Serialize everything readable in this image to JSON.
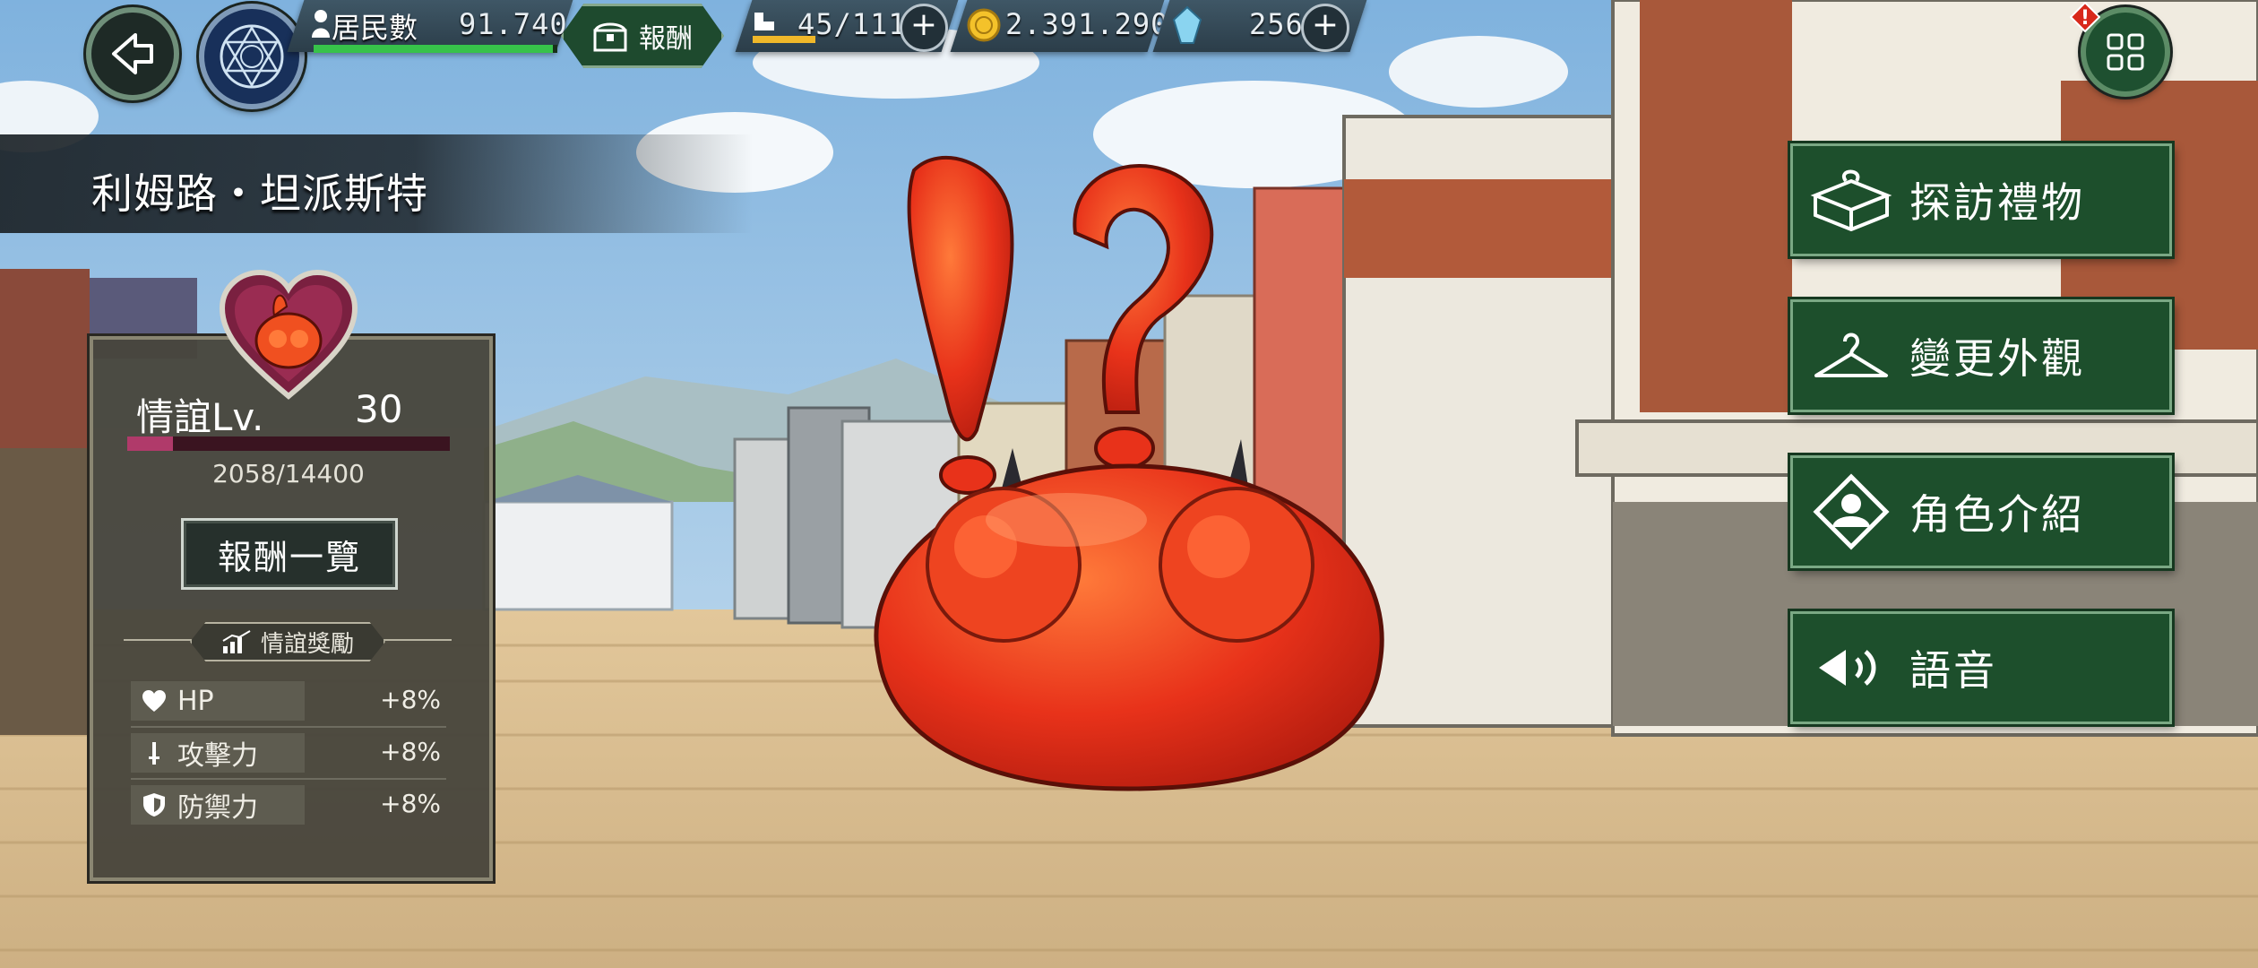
{
  "hud": {
    "residents_label": "居民數",
    "residents_value": "91.740",
    "residents_bar_fraction": 0.98,
    "reward_label": "報酬",
    "stamina": "45/111",
    "stamina_bar_fraction": 0.4,
    "gold": "2.391.290",
    "crystals": "256",
    "plus_symbol": "+",
    "alert_symbol": "!"
  },
  "character": {
    "name": "利姆路・坦派斯特"
  },
  "affection": {
    "level_label": "情誼Lv.",
    "level_value": "30",
    "exp_text": "2058/14400",
    "exp_fraction": 0.143,
    "rewards_button": "報酬一覽",
    "bonus_title": "情誼獎勵",
    "stats": [
      {
        "icon": "heart-icon",
        "label": "HP",
        "value": "+8%"
      },
      {
        "icon": "sword-icon",
        "label": "攻擊力",
        "value": "+8%"
      },
      {
        "icon": "shield-icon",
        "label": "防禦力",
        "value": "+8%"
      }
    ]
  },
  "actions": [
    {
      "icon": "gift-icon",
      "label": "探訪禮物"
    },
    {
      "icon": "hanger-icon",
      "label": "變更外觀"
    },
    {
      "icon": "profile-icon",
      "label": "角色介紹"
    },
    {
      "icon": "speaker-icon",
      "label": "語音"
    }
  ],
  "colors": {
    "panel_bg": "#48463c",
    "button_green": "#1d4f2c",
    "exp_fill": "#b03a6a",
    "slime_red": "#e8321a"
  }
}
